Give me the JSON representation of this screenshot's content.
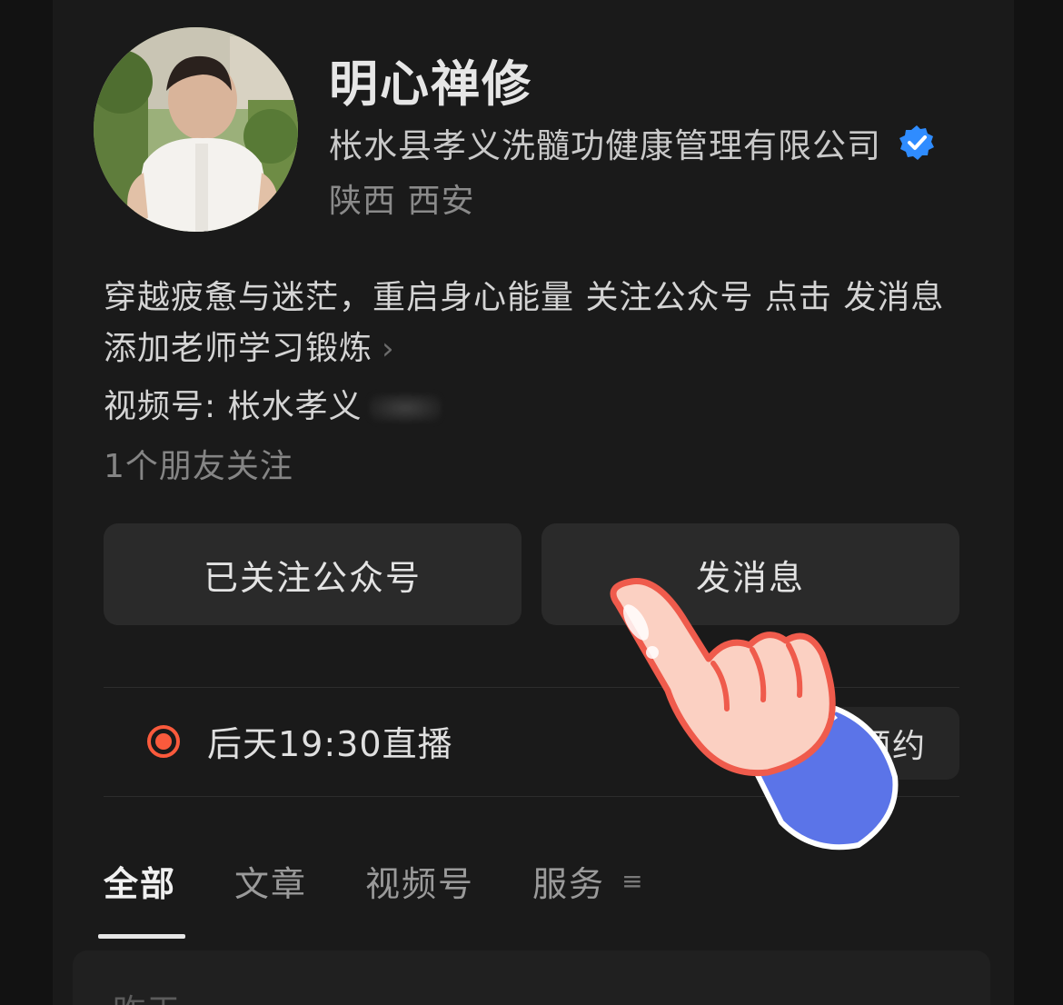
{
  "profile": {
    "name": "明心禅修",
    "company": "枨水县孝义洗髓功健康管理有限公司",
    "location": "陕西 西安",
    "bio": "穿越疲惫与迷茫，重启身心能量  关注公众号 点击 发消息 添加老师学习锻炼",
    "bio_arrow": "›",
    "channel": "视频号: 枨水孝义",
    "friends_following": "1个朋友关注"
  },
  "actions": {
    "follow_label": "已关注公众号",
    "message_label": "发消息"
  },
  "live": {
    "text": "后天19:30直播",
    "reserve_label": "预约"
  },
  "tabs": [
    {
      "label": "全部",
      "active": true
    },
    {
      "label": "文章",
      "active": false
    },
    {
      "label": "视频号",
      "active": false
    },
    {
      "label": "服务",
      "active": false
    }
  ],
  "tabs_menu_icon": "≡",
  "bottom": {
    "text": "昨天"
  },
  "colors": {
    "background": "#121212",
    "panel": "#1a1a1a",
    "button": "#2a2a2a",
    "verified": "#2f8cff",
    "live": "#fa5a3c"
  }
}
